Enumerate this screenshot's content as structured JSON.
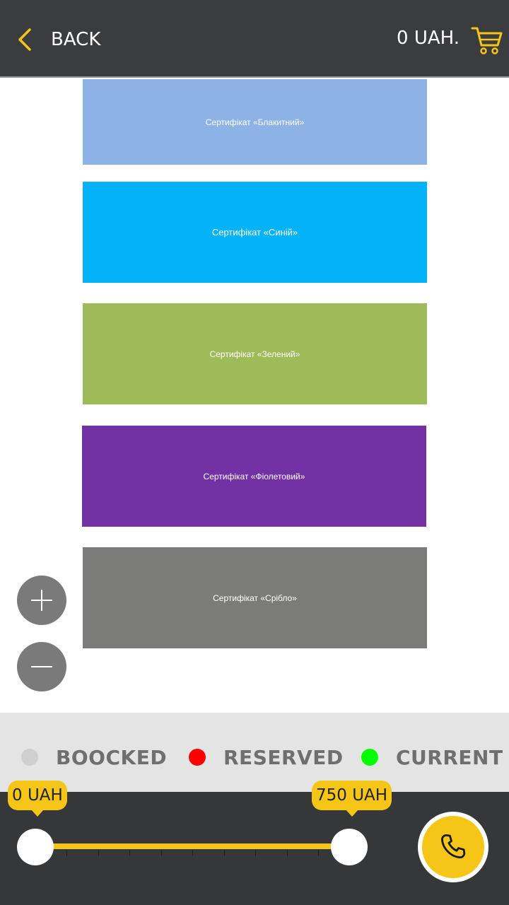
{
  "header": {
    "back_label": "BACK",
    "price": "0 UAH.",
    "icons": {
      "back": "chevron-left-icon",
      "cart": "cart-icon"
    }
  },
  "certificates": [
    {
      "label": "Сертифікат «Блакитний»",
      "color": "#8db3e6"
    },
    {
      "label": "Сертифікат «Синій»",
      "color": "#03b2f8"
    },
    {
      "label": "Сертифікат «Зелений»",
      "color": "#9dbb59"
    },
    {
      "label": "Сертифікат «Фіолетовий»",
      "color": "#7232a4"
    },
    {
      "label": "Сертифікат «Срібло»",
      "color": "#7b7c7a"
    }
  ],
  "zoom": {
    "icons": {
      "in": "plus-icon",
      "out": "minus-icon"
    }
  },
  "legend": [
    {
      "label": "BOOCKED",
      "color": "#cfcfcf"
    },
    {
      "label": "RESERVED",
      "color": "#ff0000"
    },
    {
      "label": "CURRENT",
      "color": "#00ff00"
    }
  ],
  "price_filter": {
    "min_label": "0 UAH",
    "max_label": "750 UAH",
    "min_value": 0,
    "max_value": 750,
    "range_min": 0,
    "range_max": 750
  },
  "call": {
    "icon": "phone-icon"
  },
  "colors": {
    "accent": "#f5c518",
    "header_bg": "#3b3c3e",
    "bottom_bg": "#363739",
    "legend_bg": "#e4e4e4"
  }
}
